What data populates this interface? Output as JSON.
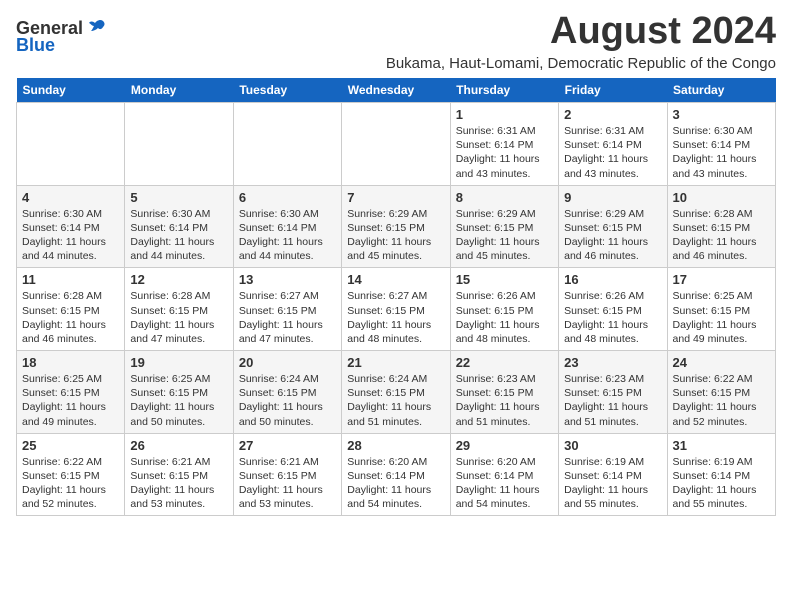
{
  "header": {
    "logo_general": "General",
    "logo_blue": "Blue",
    "month_year": "August 2024",
    "location": "Bukama, Haut-Lomami, Democratic Republic of the Congo"
  },
  "days_of_week": [
    "Sunday",
    "Monday",
    "Tuesday",
    "Wednesday",
    "Thursday",
    "Friday",
    "Saturday"
  ],
  "weeks": [
    [
      {
        "day": "",
        "info": ""
      },
      {
        "day": "",
        "info": ""
      },
      {
        "day": "",
        "info": ""
      },
      {
        "day": "",
        "info": ""
      },
      {
        "day": "1",
        "info": "Sunrise: 6:31 AM\nSunset: 6:14 PM\nDaylight: 11 hours\nand 43 minutes."
      },
      {
        "day": "2",
        "info": "Sunrise: 6:31 AM\nSunset: 6:14 PM\nDaylight: 11 hours\nand 43 minutes."
      },
      {
        "day": "3",
        "info": "Sunrise: 6:30 AM\nSunset: 6:14 PM\nDaylight: 11 hours\nand 43 minutes."
      }
    ],
    [
      {
        "day": "4",
        "info": "Sunrise: 6:30 AM\nSunset: 6:14 PM\nDaylight: 11 hours\nand 44 minutes."
      },
      {
        "day": "5",
        "info": "Sunrise: 6:30 AM\nSunset: 6:14 PM\nDaylight: 11 hours\nand 44 minutes."
      },
      {
        "day": "6",
        "info": "Sunrise: 6:30 AM\nSunset: 6:14 PM\nDaylight: 11 hours\nand 44 minutes."
      },
      {
        "day": "7",
        "info": "Sunrise: 6:29 AM\nSunset: 6:15 PM\nDaylight: 11 hours\nand 45 minutes."
      },
      {
        "day": "8",
        "info": "Sunrise: 6:29 AM\nSunset: 6:15 PM\nDaylight: 11 hours\nand 45 minutes."
      },
      {
        "day": "9",
        "info": "Sunrise: 6:29 AM\nSunset: 6:15 PM\nDaylight: 11 hours\nand 46 minutes."
      },
      {
        "day": "10",
        "info": "Sunrise: 6:28 AM\nSunset: 6:15 PM\nDaylight: 11 hours\nand 46 minutes."
      }
    ],
    [
      {
        "day": "11",
        "info": "Sunrise: 6:28 AM\nSunset: 6:15 PM\nDaylight: 11 hours\nand 46 minutes."
      },
      {
        "day": "12",
        "info": "Sunrise: 6:28 AM\nSunset: 6:15 PM\nDaylight: 11 hours\nand 47 minutes."
      },
      {
        "day": "13",
        "info": "Sunrise: 6:27 AM\nSunset: 6:15 PM\nDaylight: 11 hours\nand 47 minutes."
      },
      {
        "day": "14",
        "info": "Sunrise: 6:27 AM\nSunset: 6:15 PM\nDaylight: 11 hours\nand 48 minutes."
      },
      {
        "day": "15",
        "info": "Sunrise: 6:26 AM\nSunset: 6:15 PM\nDaylight: 11 hours\nand 48 minutes."
      },
      {
        "day": "16",
        "info": "Sunrise: 6:26 AM\nSunset: 6:15 PM\nDaylight: 11 hours\nand 48 minutes."
      },
      {
        "day": "17",
        "info": "Sunrise: 6:25 AM\nSunset: 6:15 PM\nDaylight: 11 hours\nand 49 minutes."
      }
    ],
    [
      {
        "day": "18",
        "info": "Sunrise: 6:25 AM\nSunset: 6:15 PM\nDaylight: 11 hours\nand 49 minutes."
      },
      {
        "day": "19",
        "info": "Sunrise: 6:25 AM\nSunset: 6:15 PM\nDaylight: 11 hours\nand 50 minutes."
      },
      {
        "day": "20",
        "info": "Sunrise: 6:24 AM\nSunset: 6:15 PM\nDaylight: 11 hours\nand 50 minutes."
      },
      {
        "day": "21",
        "info": "Sunrise: 6:24 AM\nSunset: 6:15 PM\nDaylight: 11 hours\nand 51 minutes."
      },
      {
        "day": "22",
        "info": "Sunrise: 6:23 AM\nSunset: 6:15 PM\nDaylight: 11 hours\nand 51 minutes."
      },
      {
        "day": "23",
        "info": "Sunrise: 6:23 AM\nSunset: 6:15 PM\nDaylight: 11 hours\nand 51 minutes."
      },
      {
        "day": "24",
        "info": "Sunrise: 6:22 AM\nSunset: 6:15 PM\nDaylight: 11 hours\nand 52 minutes."
      }
    ],
    [
      {
        "day": "25",
        "info": "Sunrise: 6:22 AM\nSunset: 6:15 PM\nDaylight: 11 hours\nand 52 minutes."
      },
      {
        "day": "26",
        "info": "Sunrise: 6:21 AM\nSunset: 6:15 PM\nDaylight: 11 hours\nand 53 minutes."
      },
      {
        "day": "27",
        "info": "Sunrise: 6:21 AM\nSunset: 6:15 PM\nDaylight: 11 hours\nand 53 minutes."
      },
      {
        "day": "28",
        "info": "Sunrise: 6:20 AM\nSunset: 6:14 PM\nDaylight: 11 hours\nand 54 minutes."
      },
      {
        "day": "29",
        "info": "Sunrise: 6:20 AM\nSunset: 6:14 PM\nDaylight: 11 hours\nand 54 minutes."
      },
      {
        "day": "30",
        "info": "Sunrise: 6:19 AM\nSunset: 6:14 PM\nDaylight: 11 hours\nand 55 minutes."
      },
      {
        "day": "31",
        "info": "Sunrise: 6:19 AM\nSunset: 6:14 PM\nDaylight: 11 hours\nand 55 minutes."
      }
    ]
  ]
}
